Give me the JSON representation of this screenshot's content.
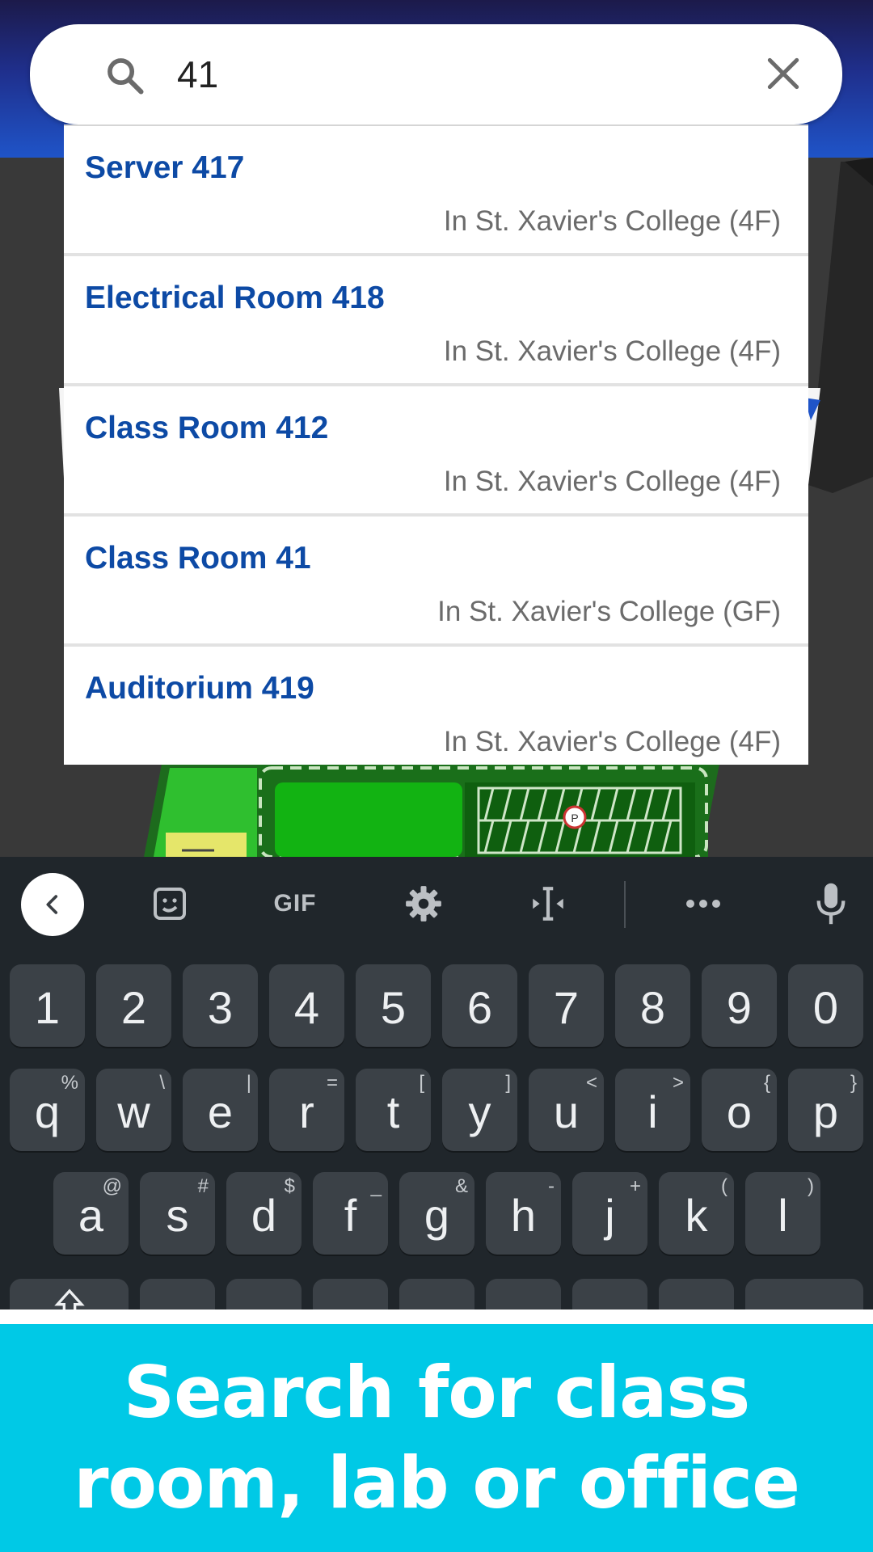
{
  "search": {
    "value": "41"
  },
  "results": [
    {
      "title": "Server 417",
      "location": "In St. Xavier's College (4F)"
    },
    {
      "title": "Electrical Room 418",
      "location": "In St. Xavier's College (4F)"
    },
    {
      "title": "Class Room 412",
      "location": "In St. Xavier's College (4F)"
    },
    {
      "title": "Class Room 41",
      "location": "In St. Xavier's College (GF)"
    },
    {
      "title": "Auditorium 419",
      "location": "In St. Xavier's College (4F)"
    }
  ],
  "map": {
    "parking_marker": "P"
  },
  "keyboard": {
    "toolbar": {
      "gif": "GIF"
    },
    "numbers": [
      "1",
      "2",
      "3",
      "4",
      "5",
      "6",
      "7",
      "8",
      "9",
      "0"
    ],
    "row1": [
      {
        "k": "q",
        "h": "%"
      },
      {
        "k": "w",
        "h": "\\"
      },
      {
        "k": "e",
        "h": "|"
      },
      {
        "k": "r",
        "h": "="
      },
      {
        "k": "t",
        "h": "["
      },
      {
        "k": "y",
        "h": "]"
      },
      {
        "k": "u",
        "h": "<"
      },
      {
        "k": "i",
        "h": ">"
      },
      {
        "k": "o",
        "h": "{"
      },
      {
        "k": "p",
        "h": "}"
      }
    ],
    "row2": [
      {
        "k": "a",
        "h": "@"
      },
      {
        "k": "s",
        "h": "#"
      },
      {
        "k": "d",
        "h": "$"
      },
      {
        "k": "f",
        "h": "_"
      },
      {
        "k": "g",
        "h": "&"
      },
      {
        "k": "h",
        "h": "-"
      },
      {
        "k": "j",
        "h": "+"
      },
      {
        "k": "k",
        "h": "("
      },
      {
        "k": "l",
        "h": ")"
      }
    ]
  },
  "banner": {
    "line1": "Search for class",
    "line2": "room, lab or office"
  },
  "colors": {
    "accent": "#0d4aa5",
    "banner": "#00c9e6",
    "keyboard": "#20262b"
  }
}
